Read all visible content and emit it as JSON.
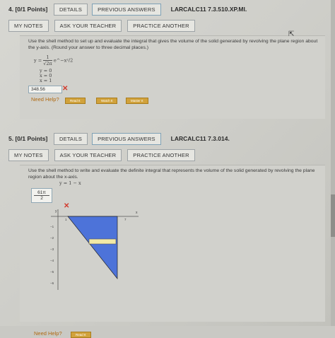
{
  "q4": {
    "number": "4.",
    "points": "[0/1 Points]",
    "details": "DETAILS",
    "previous_answers": "PREVIOUS ANSWERS",
    "code": "LARCALC11 7.3.510.XP.MI.",
    "my_notes": "MY NOTES",
    "ask_teacher": "ASK YOUR TEACHER",
    "practice_another": "PRACTICE ANOTHER",
    "prompt": "Use the shell method to set up and evaluate the integral that gives the volume of the solid generated by revolving the plane region about the y-axis. (Round your answer to three decimal places.)",
    "f1_lhs": "y =",
    "f1_num": "1",
    "f1_den": "√2π",
    "f1_exp": "e^−x²/2",
    "f2": "y = 0",
    "f3": "x = 0",
    "f4": "x = 1",
    "answer": "348.56",
    "need_help": "Need Help?",
    "read_it": "Read It",
    "watch_it": "Watch It",
    "master_it": "Master It"
  },
  "q5": {
    "number": "5.",
    "points": "[0/1 Points]",
    "details": "DETAILS",
    "previous_answers": "PREVIOUS ANSWERS",
    "code": "LARCALC11 7.3.014.",
    "my_notes": "MY NOTES",
    "ask_teacher": "ASK YOUR TEACHER",
    "practice_another": "PRACTICE ANOTHER",
    "prompt": "Use the shell method to write and evaluate the definite integral that represents the volume of the solid generated by revolving the plane region about the x-axis.",
    "equation": "y = 1 − x",
    "answer_num": "61π",
    "answer_den": "2",
    "need_help": "Need Help?",
    "read_it": "Read It",
    "graph": {
      "y_label": "y",
      "x_label": "x",
      "x_ticks": [
        "1",
        "2",
        "3",
        "4",
        "5",
        "6",
        "7"
      ],
      "y_ticks": [
        "−1",
        "−2",
        "−3",
        "−4",
        "−5",
        "−6"
      ],
      "fill_color": "#4d73d9",
      "strip_color": "#f2e9a6"
    }
  },
  "colors": {
    "error": "#d23b2e",
    "help": "#b06a12",
    "help_button": "#d1a23b"
  }
}
